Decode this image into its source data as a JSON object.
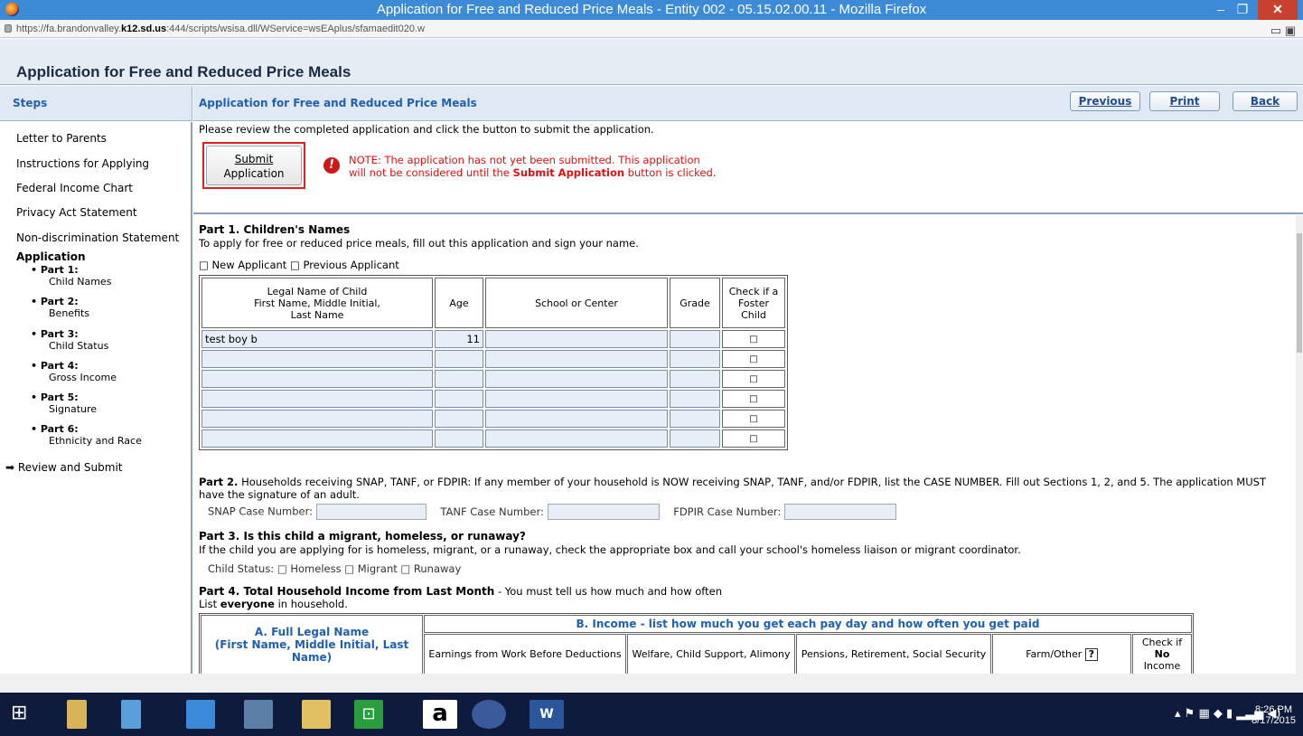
{
  "window": {
    "title": "Application for Free and Reduced Price Meals - Entity 002 - 05.15.02.00.11 - Mozilla Firefox",
    "minimize": "–",
    "restore": "❐",
    "close": "✕"
  },
  "url": {
    "prefix": "https://fa.brandonvalley.",
    "domain": "k12.sd.us",
    "suffix": ":444/scripts/wsisa.dll/WService=wsEAplus/sfamaedit020.w"
  },
  "app_title": "Application for Free and Reduced Price Meals",
  "steps_header": "Steps",
  "content_header": "Application for Free and Reduced Price Meals",
  "nav": {
    "previous": "Previous",
    "print": "Print",
    "back": "Back"
  },
  "sidebar": {
    "items": [
      "Letter to Parents",
      "Instructions for Applying",
      "Federal Income Chart",
      "Privacy Act Statement",
      "Non-discrimination Statement"
    ],
    "application": "Application",
    "parts": [
      {
        "part": "• Part 1:",
        "name": "Child Names"
      },
      {
        "part": "• Part 2:",
        "name": "Benefits"
      },
      {
        "part": "• Part 3:",
        "name": "Child Status"
      },
      {
        "part": "• Part 4:",
        "name": "Gross Income"
      },
      {
        "part": "• Part 5:",
        "name": "Signature"
      },
      {
        "part": "• Part 6:",
        "name": "Ethnicity and Race"
      }
    ],
    "review": "Review and Submit"
  },
  "notice": {
    "instruction": "Please review the completed application and click the button to submit the application.",
    "submit_line1": "Submit",
    "submit_line2": "Application",
    "note_pre": "NOTE: The application has not yet been submitted. This application",
    "note_line2_pre": "will not be considered until the ",
    "note_bold": "Submit Application",
    "note_post": " button is clicked."
  },
  "part1": {
    "title": "Part 1. Children's Names",
    "desc": "To apply for free or reduced price meals, fill out this application and sign your name.",
    "applicant_options": "□ New Applicant  □ Previous Applicant",
    "headers": {
      "name1": "Legal Name of Child",
      "name2": "First Name, Middle Initial,",
      "name3": "Last Name",
      "age": "Age",
      "school": "School or Center",
      "grade": "Grade",
      "foster1": "Check if a",
      "foster2": "Foster Child"
    },
    "rows": [
      {
        "name": "test boy b",
        "age": "11",
        "school": "",
        "grade": "",
        "foster": "□"
      },
      {
        "name": "",
        "age": "",
        "school": "",
        "grade": "",
        "foster": "□"
      },
      {
        "name": "",
        "age": "",
        "school": "",
        "grade": "",
        "foster": "□"
      },
      {
        "name": "",
        "age": "",
        "school": "",
        "grade": "",
        "foster": "□"
      },
      {
        "name": "",
        "age": "",
        "school": "",
        "grade": "",
        "foster": "□"
      },
      {
        "name": "",
        "age": "",
        "school": "",
        "grade": "",
        "foster": "□"
      }
    ]
  },
  "part2": {
    "label": "Part 2.",
    "text1": " Households receiving SNAP, TANF, or FDPIR: If any member of your household is NOW receiving SNAP, TANF, and/or FDPIR, list the CASE NUMBER. Fill out Sections 1, 2, and 5. The application MUST",
    "text2": "have the signature of an adult.",
    "snap": "SNAP Case Number:",
    "tanf": "TANF Case Number:",
    "fdpir": "FDPIR Case Number:"
  },
  "part3": {
    "title": "Part 3. Is this child a migrant, homeless, or runaway?",
    "desc": "If the child you are applying for is homeless, migrant, or a runaway, check the appropriate box and call your school's homeless liaison or migrant coordinator.",
    "status": "Child Status: □ Homeless □ Migrant □ Runaway"
  },
  "part4": {
    "title": "Part 4. Total Household Income from Last Month",
    "title_suffix": " - You must tell us how much and how often",
    "list_pre": "List ",
    "list_bold": "everyone",
    "list_post": " in household.",
    "col_a1": "A. Full Legal Name",
    "col_a2": "(First Name, Middle Initial, Last Name)",
    "col_b": "B. Income - list how much you get each pay day and how often you get paid",
    "earnings": "Earnings from Work Before Deductions",
    "welfare": "Welfare, Child Support, Alimony",
    "pensions": "Pensions, Retirement, Social Security",
    "farm": "Farm/Other",
    "help": "?",
    "noinc1": "Check if",
    "noinc2_bold": "No",
    "noinc2": " Income"
  },
  "tray": {
    "time": "8:26 PM",
    "date": "8/17/2015"
  }
}
